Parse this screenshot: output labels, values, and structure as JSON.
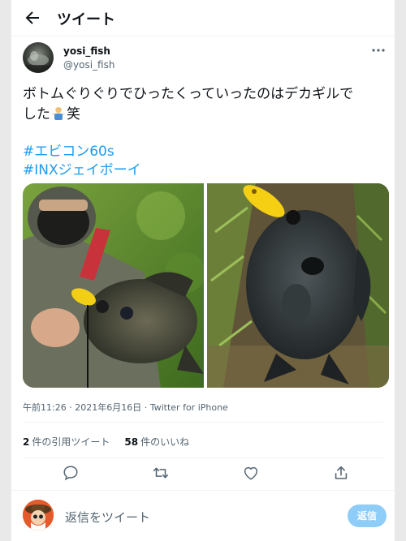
{
  "header": {
    "title": "ツイート"
  },
  "author": {
    "display_name": "yosi_fish",
    "handle": "@yosi_fish"
  },
  "tweet": {
    "text_line1": "ボトムぐりぐりでひったくっていったのはデカギルで",
    "text_line2_before": "した",
    "text_line2_after": "笑",
    "emoji": "person-shrugging",
    "hashtags": [
      "#エビコン60s",
      "#INXジェイボーイ"
    ]
  },
  "media": [
    {
      "name": "photo-angler-holding-bluegill"
    },
    {
      "name": "photo-bluegill-on-grass"
    }
  ],
  "meta": {
    "time": "午前11:26",
    "separator": " · ",
    "date": "2021年6月16日",
    "source": "Twitter for iPhone"
  },
  "stats": {
    "quote_count": "2",
    "quote_label": "件の引用ツイート",
    "like_count": "58",
    "like_label": "件のいいね"
  },
  "actions": [
    "reply-icon",
    "retweet-icon",
    "like-icon",
    "share-icon"
  ],
  "reply": {
    "placeholder": "返信をツイート",
    "button_label": "返信"
  },
  "colors": {
    "accent": "#1d9bf0",
    "secondary_text": "#536471",
    "reply_button": "#8ecdf7"
  }
}
